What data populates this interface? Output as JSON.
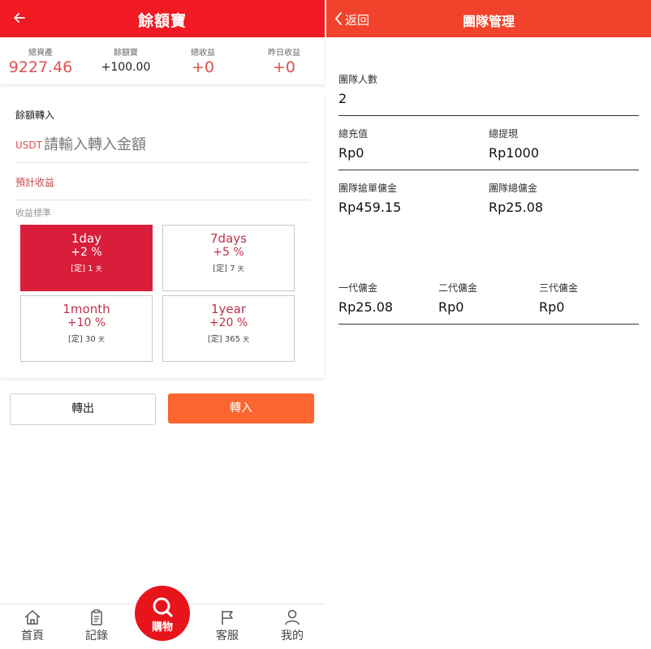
{
  "left": {
    "title": "餘額寶",
    "stats": [
      {
        "label": "總資產",
        "value": "9227.46"
      },
      {
        "label": "餘額寶",
        "value": "+100.00"
      },
      {
        "label": "總收益",
        "value": "+0"
      },
      {
        "label": "昨日收益",
        "value": "+0"
      }
    ],
    "transfer_label": "餘額轉入",
    "currency": "USDT",
    "amount_placeholder": "請輸入轉入金額",
    "estimated_label": "預計收益",
    "standard_label": "收益標準",
    "plans": [
      {
        "name": "1day",
        "rate": "+2 %",
        "fixed": "[定]",
        "days": "1",
        "unit": "天",
        "active": true
      },
      {
        "name": "7days",
        "rate": "+5 %",
        "fixed": "[定]",
        "days": "7",
        "unit": "天",
        "active": false
      },
      {
        "name": "1month",
        "rate": "+10 %",
        "fixed": "[定]",
        "days": "30",
        "unit": "天",
        "active": false
      },
      {
        "name": "1year",
        "rate": "+20 %",
        "fixed": "[定]",
        "days": "365",
        "unit": "天",
        "active": false
      }
    ],
    "transfer_out_label": "轉出",
    "transfer_in_label": "轉入",
    "tabs": {
      "home": "首頁",
      "records": "記錄",
      "shop": "購物",
      "service": "客服",
      "mine": "我的"
    }
  },
  "right": {
    "back_label": "返回",
    "title": "團隊管理",
    "team_count_label": "團隊人數",
    "team_count": "2",
    "total_recharge_label": "總充值",
    "total_recharge": "Rp0",
    "total_withdraw_label": "總提現",
    "total_withdraw": "Rp1000",
    "grab_commission_label": "團隊搶單傭金",
    "grab_commission": "Rp459.15",
    "total_commission_label": "團隊總傭金",
    "total_commission": "Rp25.08",
    "gen1_label": "一代傭金",
    "gen1_value": "Rp25.08",
    "gen2_label": "二代傭金",
    "gen2_value": "Rp0",
    "gen3_label": "三代傭金",
    "gen3_value": "Rp0"
  },
  "colors": {
    "left_header": "#f11a22",
    "right_header": "#f1432b",
    "accent_red": "#e05050",
    "plan_active": "#d81e3a",
    "transfer_in_button": "#fc6530",
    "shop_button": "#e8141c"
  },
  "icons": {
    "back": "arrow-left-icon",
    "right_back": "chevron-left-icon",
    "home": "home-icon",
    "records": "clipboard-icon",
    "shop": "search-icon",
    "service": "flag-icon",
    "mine": "user-icon"
  }
}
